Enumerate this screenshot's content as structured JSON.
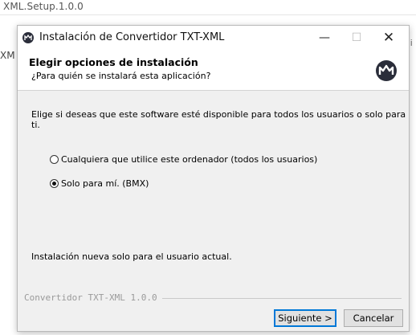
{
  "background": {
    "window_title_fragment": "XML.Setup.1.0.0",
    "left_fragment": "XM",
    "right_fragment": "i"
  },
  "window": {
    "title": "Instalación de Convertidor TXT-XML",
    "controls": {
      "minimize": "—",
      "maximize": "☐",
      "close": "✕"
    }
  },
  "header": {
    "title": "Elegir opciones de instalación",
    "subtitle": "¿Para quién se instalará esta aplicación?"
  },
  "content": {
    "prompt": "Elige si deseas que este software esté disponible para todos los usuarios o solo para ti.",
    "options": [
      {
        "label": "Cualquiera que utilice este ordenador (todos los usuarios)",
        "selected": false
      },
      {
        "label": "Solo para mí. (BMX)",
        "selected": true
      }
    ],
    "info": "Instalación nueva solo para el usuario actual."
  },
  "footer": {
    "branding": "Convertidor TXT-XML 1.0.0",
    "next_label": "Siguiente >",
    "cancel_label": "Cancelar"
  },
  "colors": {
    "accent": "#0078d7",
    "logo_bg": "#2a2d3a"
  }
}
